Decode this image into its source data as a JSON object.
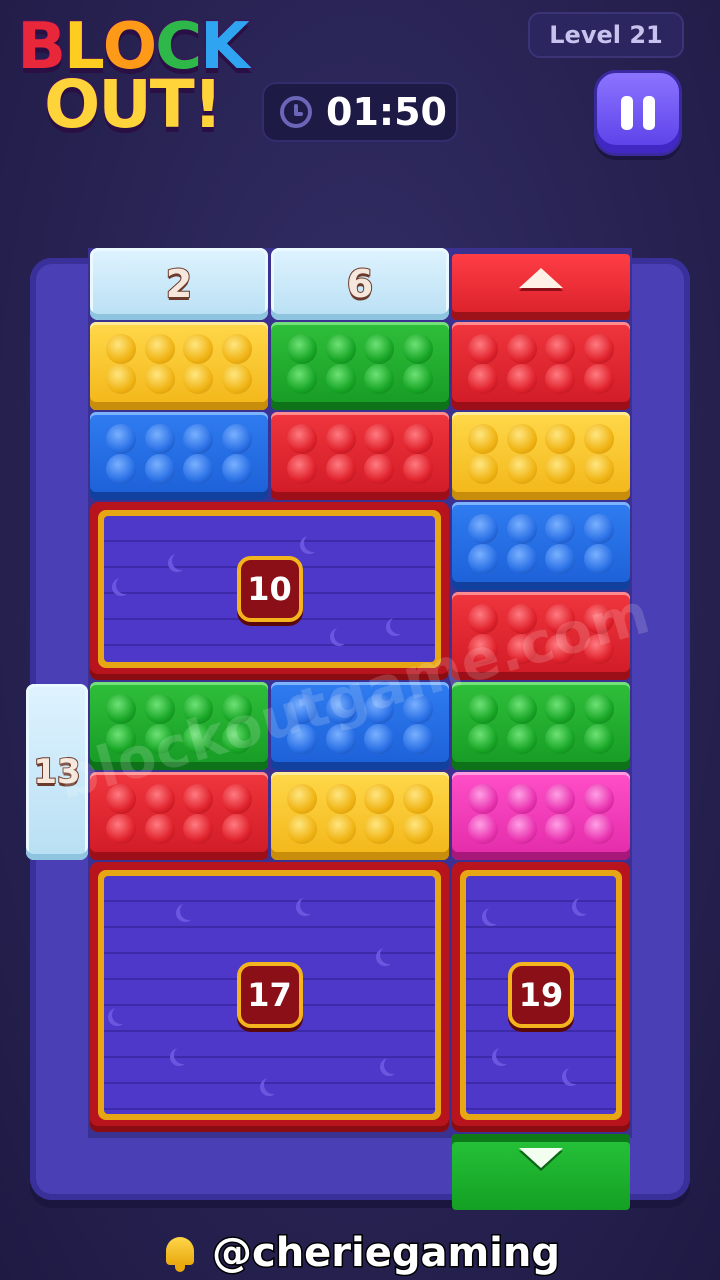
{
  "logo": {
    "line1": [
      "B",
      "L",
      "O",
      "C",
      "K"
    ],
    "line2": [
      "O",
      "U",
      "T",
      "!"
    ],
    "line1_colors": [
      "#e8283a",
      "#ffcc22",
      "#ff9a18",
      "#2fb84a",
      "#2fa4f0"
    ],
    "line2_colors": [
      "#ffd43a",
      "#ffd43a",
      "#ffd43a",
      "#ffd43a"
    ]
  },
  "header": {
    "level_label": "Level 21",
    "timer": "01:50",
    "clock_icon": "clock-icon",
    "pause_icon": "pause-icon"
  },
  "board": {
    "ice_blocks": [
      {
        "id": "ice-2",
        "value": "2"
      },
      {
        "id": "ice-6",
        "value": "6"
      },
      {
        "id": "ice-13",
        "value": "13"
      }
    ],
    "boxes": [
      {
        "id": "box-10",
        "value": "10"
      },
      {
        "id": "box-17",
        "value": "17"
      },
      {
        "id": "box-19",
        "value": "19"
      }
    ],
    "bricks": [
      {
        "color": "yellow"
      },
      {
        "color": "green"
      },
      {
        "color": "red"
      },
      {
        "color": "blue"
      },
      {
        "color": "red"
      },
      {
        "color": "yellow"
      },
      {
        "color": "blue"
      },
      {
        "color": "red"
      },
      {
        "color": "green"
      },
      {
        "color": "blue"
      },
      {
        "color": "green"
      },
      {
        "color": "red"
      },
      {
        "color": "yellow"
      },
      {
        "color": "pink"
      }
    ],
    "exit_gates": [
      {
        "color": "red",
        "direction": "up"
      },
      {
        "color": "green",
        "direction": "down"
      }
    ]
  },
  "watermark": "blockoutgame.com",
  "footer": {
    "icon": "bell-icon",
    "handle": "@cheriegaming"
  },
  "colors": {
    "background": "#272251",
    "board": "#4a3fb4",
    "pause_button": "#6f52f4",
    "box_border": "#e7a614",
    "box_red": "#b8141d"
  }
}
